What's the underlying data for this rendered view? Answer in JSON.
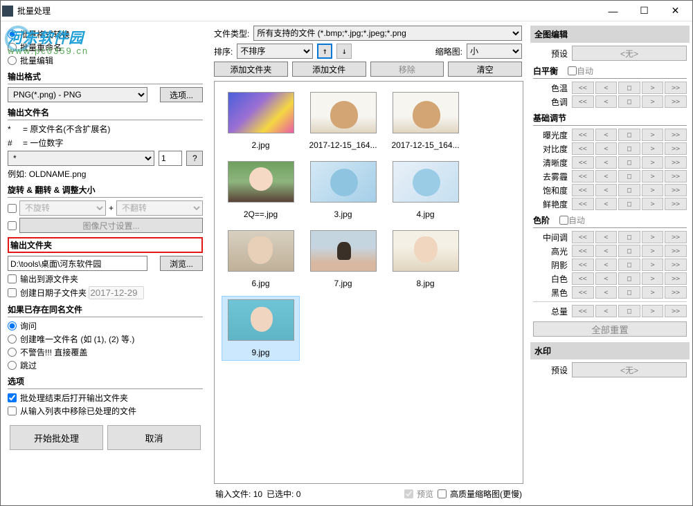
{
  "window": {
    "title": "批量处理"
  },
  "titlebar": {
    "min": "—",
    "max": "☐",
    "close": "✕"
  },
  "left": {
    "mode": {
      "opt1": "批量格式转换",
      "opt2": "批量重命名",
      "opt3": "批量编辑"
    },
    "output_format": {
      "head": "输出格式",
      "value": "PNG(*.png) - PNG",
      "options_btn": "选项..."
    },
    "output_name": {
      "head": "输出文件名",
      "hint1_sym": "*",
      "hint1_txt": "= 原文件名(不含扩展名)",
      "hint2_sym": "#",
      "hint2_txt": "= 一位数字",
      "pattern": "*",
      "number": "1",
      "help": "?",
      "example_label": "例如:",
      "example_value": "OLDNAME.png"
    },
    "rotate": {
      "head": "旋转 & 翻转 & 调整大小",
      "rot": "不旋转",
      "flip": "不翻转",
      "plus": "+",
      "size_btn": "图像尺寸设置..."
    },
    "output_folder": {
      "head": "输出文件夹",
      "path": "D:\\tools\\桌面\\河东软件园",
      "browse": "浏览...",
      "opt_source": "输出到源文件夹",
      "opt_date": "创建日期子文件夹",
      "date": "2017-12-29"
    },
    "exists": {
      "head": "如果已存在同名文件",
      "opt1": "询问",
      "opt2": "创建唯一文件名 (如 (1), (2) 等.)",
      "opt3": "不警告!!! 直接覆盖",
      "opt4": "跳过"
    },
    "options": {
      "head": "选项",
      "opt1": "批处理结束后打开输出文件夹",
      "opt2": "从输入列表中移除已处理的文件"
    },
    "bottom": {
      "start": "开始批处理",
      "cancel": "取消"
    },
    "watermark": {
      "brand": "河东软件园",
      "url": "www.pc0359.cn"
    }
  },
  "center": {
    "filetype_label": "文件类型:",
    "filetype": "所有支持的文件 (*.bmp;*.jpg;*.jpeg;*.png",
    "sort_label": "排序:",
    "sort": "不排序",
    "thumb_label": "缩略图:",
    "thumb_size": "小",
    "btn_addfolder": "添加文件夹",
    "btn_addfile": "添加文件",
    "btn_remove": "移除",
    "btn_clear": "清空",
    "thumbs": [
      {
        "label": "2.jpg",
        "cls": "anime1"
      },
      {
        "label": "2017-12-15_164...",
        "cls": "dog"
      },
      {
        "label": "2017-12-15_164...",
        "cls": "dog"
      },
      {
        "label": "2Q==.jpg",
        "cls": "camera-girl"
      },
      {
        "label": "3.jpg",
        "cls": "rem1"
      },
      {
        "label": "4.jpg",
        "cls": "rem2"
      },
      {
        "label": "6.jpg",
        "cls": "woman1"
      },
      {
        "label": "7.jpg",
        "cls": "girl-beach"
      },
      {
        "label": "8.jpg",
        "cls": "woman2"
      },
      {
        "label": "9.jpg",
        "cls": "woman3",
        "selected": true
      }
    ],
    "status": {
      "input_label": "输入文件:",
      "input_count": "10",
      "sel_label": "已选中:",
      "sel_count": "0"
    },
    "preview": "预览",
    "hq_thumb": "高质量缩略图(更慢)"
  },
  "right": {
    "head_full": "全图编辑",
    "preset_label": "预设",
    "preset_none": "<无>",
    "wb_head": "白平衡",
    "wb_auto": "自动",
    "wb_temp": "色温",
    "wb_tint": "色调",
    "basic_head": "基础调节",
    "exposure": "曝光度",
    "contrast": "对比度",
    "clarity": "清晰度",
    "dehaze": "去雾霾",
    "saturation": "饱和度",
    "vibrance": "鲜艳度",
    "levels_head": "色阶",
    "levels_auto": "自动",
    "midtones": "中间调",
    "highlights": "高光",
    "shadows": "阴影",
    "white": "白色",
    "black": "黑色",
    "total": "总量",
    "reset_all": "全部重置",
    "watermark_head": "水印",
    "slider_syms": [
      "<<",
      "<",
      "□",
      ">",
      ">>"
    ]
  }
}
